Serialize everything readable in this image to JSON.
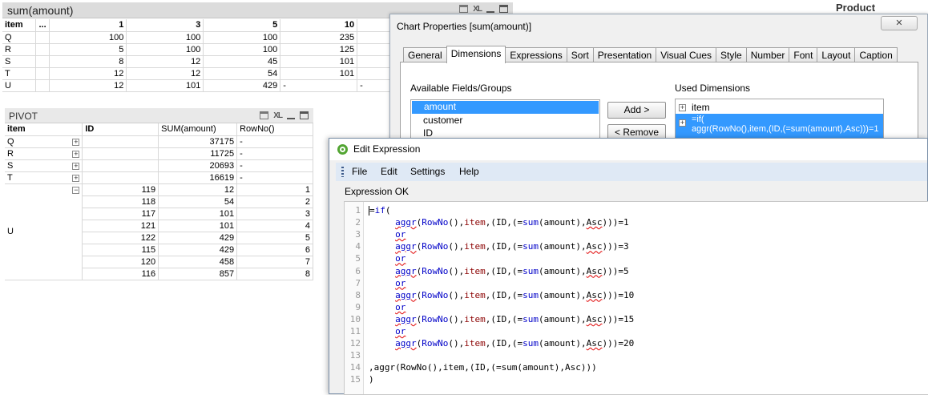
{
  "sum_table": {
    "title": "sum(amount)",
    "icons": {
      "print": "print-icon",
      "xl": "XL",
      "minimize": "minimize-icon",
      "maximize": "maximize-icon"
    },
    "header": [
      "item",
      "...",
      "1",
      "3",
      "5",
      "10",
      "",
      ""
    ],
    "rows": [
      [
        "Q",
        "",
        "100",
        "100",
        "100",
        "235",
        "",
        ""
      ],
      [
        "R",
        "",
        "5",
        "100",
        "100",
        "125",
        "",
        ""
      ],
      [
        "S",
        "",
        "8",
        "12",
        "45",
        "101",
        "",
        ""
      ],
      [
        "T",
        "",
        "12",
        "12",
        "54",
        "101",
        "",
        ""
      ],
      [
        "U",
        "",
        "12",
        "101",
        "429",
        "-",
        "-",
        ""
      ]
    ]
  },
  "pivot": {
    "title": "PIVOT",
    "headers": [
      "item",
      "ID",
      "SUM(amount)",
      "RowNo()"
    ],
    "collapsed_rows": [
      {
        "item": "Q",
        "sum": "37175",
        "rowno": "-"
      },
      {
        "item": "R",
        "sum": "11725",
        "rowno": "-"
      },
      {
        "item": "S",
        "sum": "20693",
        "rowno": "-"
      },
      {
        "item": "T",
        "sum": "16619",
        "rowno": "-"
      }
    ],
    "expanded_item": "U",
    "expanded_rows": [
      {
        "id": "119",
        "sum": "12",
        "rowno": "1"
      },
      {
        "id": "118",
        "sum": "54",
        "rowno": "2"
      },
      {
        "id": "117",
        "sum": "101",
        "rowno": "3"
      },
      {
        "id": "121",
        "sum": "101",
        "rowno": "4"
      },
      {
        "id": "122",
        "sum": "429",
        "rowno": "5"
      },
      {
        "id": "115",
        "sum": "429",
        "rowno": "6"
      },
      {
        "id": "120",
        "sum": "458",
        "rowno": "7"
      },
      {
        "id": "116",
        "sum": "857",
        "rowno": "8"
      }
    ]
  },
  "product_label": "Product",
  "chart_properties": {
    "title": "Chart Properties [sum(amount)]",
    "close_label": "✕",
    "tabs": [
      "General",
      "Dimensions",
      "Expressions",
      "Sort",
      "Presentation",
      "Visual Cues",
      "Style",
      "Number",
      "Font",
      "Layout",
      "Caption"
    ],
    "active_tab": "Dimensions",
    "available_label": "Available Fields/Groups",
    "available_fields": [
      "amount",
      "customer",
      "ID"
    ],
    "add_button": "Add >",
    "remove_button": "< Remove",
    "used_label": "Used Dimensions",
    "used_dimensions": [
      "item",
      "=if(",
      "aggr(RowNo(),item,(ID,(=sum(amount),Asc)))=1"
    ]
  },
  "edit_expression": {
    "title": "Edit Expression",
    "menu": [
      "File",
      "Edit",
      "Settings",
      "Help"
    ],
    "status": "Expression OK",
    "line_numbers": [
      "1",
      "2",
      "3",
      "4",
      "5",
      "6",
      "7",
      "8",
      "9",
      "10",
      "11",
      "12",
      "13",
      "14",
      "15"
    ],
    "lines": [
      "=if(",
      "     aggr(RowNo(),item,(ID,(=sum(amount),Asc)))=1",
      "     or",
      "     aggr(RowNo(),item,(ID,(=sum(amount),Asc)))=3",
      "     or",
      "     aggr(RowNo(),item,(ID,(=sum(amount),Asc)))=5",
      "     or",
      "     aggr(RowNo(),item,(ID,(=sum(amount),Asc)))=10",
      "     or",
      "     aggr(RowNo(),item,(ID,(=sum(amount),Asc)))=15",
      "     or",
      "     aggr(RowNo(),item,(ID,(=sum(amount),Asc)))=20",
      "",
      ",aggr(RowNo(),item,(ID,(=sum(amount),Asc)))",
      ")"
    ]
  },
  "colors": {
    "selection": "#3399ff",
    "menubar": "#dfe9f5",
    "keyword": "#0000c8",
    "squiggle": "#e00000"
  }
}
